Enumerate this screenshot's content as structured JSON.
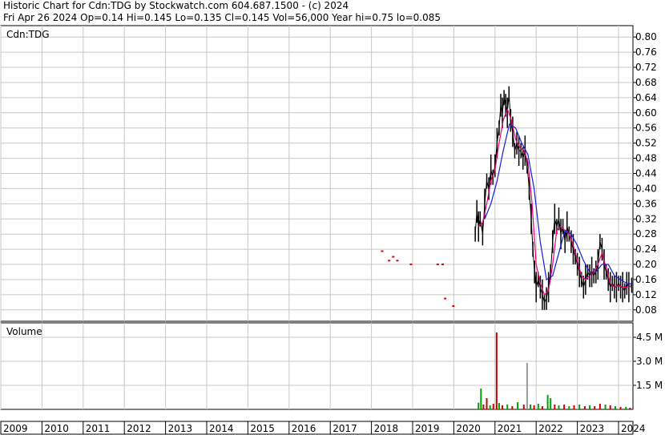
{
  "header": {
    "line1": "Historic Chart for Cdn:TDG by Stockwatch.com 604.687.1500 - (c) 2024",
    "line2": "Fri Apr 26 2024   Op=0.14  Hi=0.145  Lo=0.135  Cl=0.145  Vol=56,000  Year hi=0.75  lo=0.085"
  },
  "chart_data": {
    "type": "line",
    "title": "Cdn:TDG",
    "price_axis": {
      "ylim": [
        0.05,
        0.83
      ],
      "ticks": [
        "0.80",
        "0.76",
        "0.72",
        "0.68",
        "0.64",
        "0.60",
        "0.56",
        "0.52",
        "0.48",
        "0.44",
        "0.40",
        "0.36",
        "0.32",
        "0.28",
        "0.24",
        "0.20",
        "0.16",
        "0.12",
        "0.08"
      ]
    },
    "volume_panel": {
      "label": "Volume",
      "ylim": [
        0,
        5400000
      ],
      "ticks": [
        {
          "value": 4500000,
          "label": "4.5 M"
        },
        {
          "value": 3000000,
          "label": "3.0 M"
        },
        {
          "value": 1500000,
          "label": "1.5 M"
        }
      ]
    },
    "x_axis": {
      "xlim": [
        2009.0,
        2024.35
      ],
      "years": [
        "2009",
        "2010",
        "2011",
        "2012",
        "2013",
        "2014",
        "2015",
        "2016",
        "2017",
        "2018",
        "2019",
        "2020",
        "2021",
        "2022",
        "2023",
        "2024"
      ]
    },
    "grid": true,
    "colors": {
      "price": "#000000",
      "ma_short": "#e8007a",
      "ma_long": "#1a1adc",
      "sparse_price": "#dd0000",
      "volume_up": "#cc0000",
      "volume_down": "#00a000",
      "volume_flat": "#9a9a9a"
    },
    "sparse_points": [
      {
        "x": 2018.25,
        "y": 0.235
      },
      {
        "x": 2018.42,
        "y": 0.21
      },
      {
        "x": 2018.52,
        "y": 0.22
      },
      {
        "x": 2018.62,
        "y": 0.21
      },
      {
        "x": 2018.95,
        "y": 0.2
      },
      {
        "x": 2019.6,
        "y": 0.2
      },
      {
        "x": 2019.72,
        "y": 0.2
      },
      {
        "x": 2019.78,
        "y": 0.11
      },
      {
        "x": 2019.98,
        "y": 0.09
      }
    ],
    "price_series": [
      [
        2020.52,
        0.28
      ],
      [
        2020.56,
        0.34
      ],
      [
        2020.6,
        0.3
      ],
      [
        2020.64,
        0.32
      ],
      [
        2020.7,
        0.28
      ],
      [
        2020.75,
        0.36
      ],
      [
        2020.8,
        0.42
      ],
      [
        2020.85,
        0.4
      ],
      [
        2020.9,
        0.45
      ],
      [
        2020.95,
        0.43
      ],
      [
        2021.0,
        0.46
      ],
      [
        2021.05,
        0.52
      ],
      [
        2021.1,
        0.56
      ],
      [
        2021.14,
        0.62
      ],
      [
        2021.18,
        0.6
      ],
      [
        2021.22,
        0.64
      ],
      [
        2021.26,
        0.62
      ],
      [
        2021.3,
        0.6
      ],
      [
        2021.34,
        0.65
      ],
      [
        2021.38,
        0.58
      ],
      [
        2021.43,
        0.55
      ],
      [
        2021.48,
        0.5
      ],
      [
        2021.53,
        0.52
      ],
      [
        2021.58,
        0.5
      ],
      [
        2021.63,
        0.5
      ],
      [
        2021.68,
        0.48
      ],
      [
        2021.73,
        0.5
      ],
      [
        2021.78,
        0.46
      ],
      [
        2021.83,
        0.4
      ],
      [
        2021.88,
        0.32
      ],
      [
        2021.92,
        0.24
      ],
      [
        2021.96,
        0.18
      ],
      [
        2022.0,
        0.14
      ],
      [
        2022.05,
        0.16
      ],
      [
        2022.1,
        0.14
      ],
      [
        2022.15,
        0.12
      ],
      [
        2022.2,
        0.1
      ],
      [
        2022.25,
        0.11
      ],
      [
        2022.3,
        0.14
      ],
      [
        2022.35,
        0.18
      ],
      [
        2022.4,
        0.26
      ],
      [
        2022.45,
        0.32
      ],
      [
        2022.5,
        0.3
      ],
      [
        2022.55,
        0.32
      ],
      [
        2022.6,
        0.28
      ],
      [
        2022.65,
        0.3
      ],
      [
        2022.7,
        0.26
      ],
      [
        2022.75,
        0.3
      ],
      [
        2022.8,
        0.28
      ],
      [
        2022.85,
        0.26
      ],
      [
        2022.9,
        0.24
      ],
      [
        2022.95,
        0.22
      ],
      [
        2023.0,
        0.2
      ],
      [
        2023.05,
        0.18
      ],
      [
        2023.1,
        0.16
      ],
      [
        2023.15,
        0.14
      ],
      [
        2023.2,
        0.16
      ],
      [
        2023.25,
        0.18
      ],
      [
        2023.3,
        0.17
      ],
      [
        2023.35,
        0.18
      ],
      [
        2023.4,
        0.17
      ],
      [
        2023.45,
        0.18
      ],
      [
        2023.5,
        0.2
      ],
      [
        2023.55,
        0.26
      ],
      [
        2023.6,
        0.24
      ],
      [
        2023.65,
        0.2
      ],
      [
        2023.7,
        0.18
      ],
      [
        2023.75,
        0.16
      ],
      [
        2023.8,
        0.14
      ],
      [
        2023.85,
        0.15
      ],
      [
        2023.9,
        0.14
      ],
      [
        2023.95,
        0.14
      ],
      [
        2024.0,
        0.15
      ],
      [
        2024.05,
        0.14
      ],
      [
        2024.1,
        0.14
      ],
      [
        2024.15,
        0.13
      ],
      [
        2024.2,
        0.15
      ],
      [
        2024.25,
        0.14
      ],
      [
        2024.32,
        0.145
      ]
    ],
    "ma_short": [
      [
        2020.6,
        0.3
      ],
      [
        2020.7,
        0.31
      ],
      [
        2020.8,
        0.36
      ],
      [
        2020.9,
        0.42
      ],
      [
        2021.0,
        0.45
      ],
      [
        2021.1,
        0.52
      ],
      [
        2021.2,
        0.58
      ],
      [
        2021.3,
        0.61
      ],
      [
        2021.4,
        0.58
      ],
      [
        2021.5,
        0.53
      ],
      [
        2021.6,
        0.51
      ],
      [
        2021.7,
        0.5
      ],
      [
        2021.8,
        0.47
      ],
      [
        2021.9,
        0.36
      ],
      [
        2022.0,
        0.2
      ],
      [
        2022.1,
        0.15
      ],
      [
        2022.2,
        0.12
      ],
      [
        2022.3,
        0.13
      ],
      [
        2022.4,
        0.2
      ],
      [
        2022.5,
        0.29
      ],
      [
        2022.6,
        0.3
      ],
      [
        2022.7,
        0.29
      ],
      [
        2022.8,
        0.28
      ],
      [
        2022.9,
        0.25
      ],
      [
        2023.0,
        0.21
      ],
      [
        2023.1,
        0.17
      ],
      [
        2023.2,
        0.16
      ],
      [
        2023.3,
        0.17
      ],
      [
        2023.4,
        0.18
      ],
      [
        2023.5,
        0.2
      ],
      [
        2023.6,
        0.23
      ],
      [
        2023.7,
        0.19
      ],
      [
        2023.8,
        0.15
      ],
      [
        2023.9,
        0.14
      ],
      [
        2024.0,
        0.145
      ],
      [
        2024.1,
        0.14
      ],
      [
        2024.2,
        0.14
      ],
      [
        2024.32,
        0.142
      ]
    ],
    "ma_long": [
      [
        2020.75,
        0.32
      ],
      [
        2020.9,
        0.36
      ],
      [
        2021.05,
        0.42
      ],
      [
        2021.2,
        0.5
      ],
      [
        2021.35,
        0.57
      ],
      [
        2021.5,
        0.56
      ],
      [
        2021.65,
        0.52
      ],
      [
        2021.8,
        0.49
      ],
      [
        2021.95,
        0.4
      ],
      [
        2022.1,
        0.26
      ],
      [
        2022.25,
        0.16
      ],
      [
        2022.4,
        0.17
      ],
      [
        2022.55,
        0.23
      ],
      [
        2022.7,
        0.29
      ],
      [
        2022.85,
        0.28
      ],
      [
        2023.0,
        0.25
      ],
      [
        2023.15,
        0.21
      ],
      [
        2023.3,
        0.18
      ],
      [
        2023.45,
        0.18
      ],
      [
        2023.6,
        0.2
      ],
      [
        2023.75,
        0.2
      ],
      [
        2023.9,
        0.17
      ],
      [
        2024.05,
        0.16
      ],
      [
        2024.2,
        0.15
      ],
      [
        2024.32,
        0.148
      ]
    ],
    "volume": [
      {
        "x": 2020.6,
        "v": 420000,
        "c": "green"
      },
      {
        "x": 2020.66,
        "v": 1300000,
        "c": "green"
      },
      {
        "x": 2020.72,
        "v": 300000,
        "c": "red"
      },
      {
        "x": 2020.8,
        "v": 700000,
        "c": "red"
      },
      {
        "x": 2020.88,
        "v": 250000,
        "c": "green"
      },
      {
        "x": 2020.96,
        "v": 350000,
        "c": "red"
      },
      {
        "x": 2021.04,
        "v": 4800000,
        "c": "red"
      },
      {
        "x": 2021.1,
        "v": 400000,
        "c": "green"
      },
      {
        "x": 2021.18,
        "v": 250000,
        "c": "red"
      },
      {
        "x": 2021.3,
        "v": 300000,
        "c": "green"
      },
      {
        "x": 2021.42,
        "v": 200000,
        "c": "red"
      },
      {
        "x": 2021.55,
        "v": 450000,
        "c": "green"
      },
      {
        "x": 2021.7,
        "v": 300000,
        "c": "red"
      },
      {
        "x": 2021.78,
        "v": 2900000,
        "c": "gray"
      },
      {
        "x": 2021.86,
        "v": 300000,
        "c": "green"
      },
      {
        "x": 2021.95,
        "v": 250000,
        "c": "red"
      },
      {
        "x": 2022.05,
        "v": 350000,
        "c": "green"
      },
      {
        "x": 2022.15,
        "v": 200000,
        "c": "red"
      },
      {
        "x": 2022.28,
        "v": 900000,
        "c": "green"
      },
      {
        "x": 2022.35,
        "v": 700000,
        "c": "green"
      },
      {
        "x": 2022.45,
        "v": 300000,
        "c": "red"
      },
      {
        "x": 2022.55,
        "v": 250000,
        "c": "green"
      },
      {
        "x": 2022.68,
        "v": 300000,
        "c": "red"
      },
      {
        "x": 2022.8,
        "v": 200000,
        "c": "green"
      },
      {
        "x": 2022.92,
        "v": 250000,
        "c": "red"
      },
      {
        "x": 2023.05,
        "v": 300000,
        "c": "green"
      },
      {
        "x": 2023.18,
        "v": 200000,
        "c": "red"
      },
      {
        "x": 2023.3,
        "v": 250000,
        "c": "green"
      },
      {
        "x": 2023.42,
        "v": 200000,
        "c": "red"
      },
      {
        "x": 2023.55,
        "v": 350000,
        "c": "red"
      },
      {
        "x": 2023.68,
        "v": 300000,
        "c": "green"
      },
      {
        "x": 2023.8,
        "v": 250000,
        "c": "red"
      },
      {
        "x": 2023.92,
        "v": 200000,
        "c": "green"
      },
      {
        "x": 2024.05,
        "v": 150000,
        "c": "red"
      },
      {
        "x": 2024.18,
        "v": 150000,
        "c": "green"
      },
      {
        "x": 2024.28,
        "v": 100000,
        "c": "red"
      }
    ]
  }
}
